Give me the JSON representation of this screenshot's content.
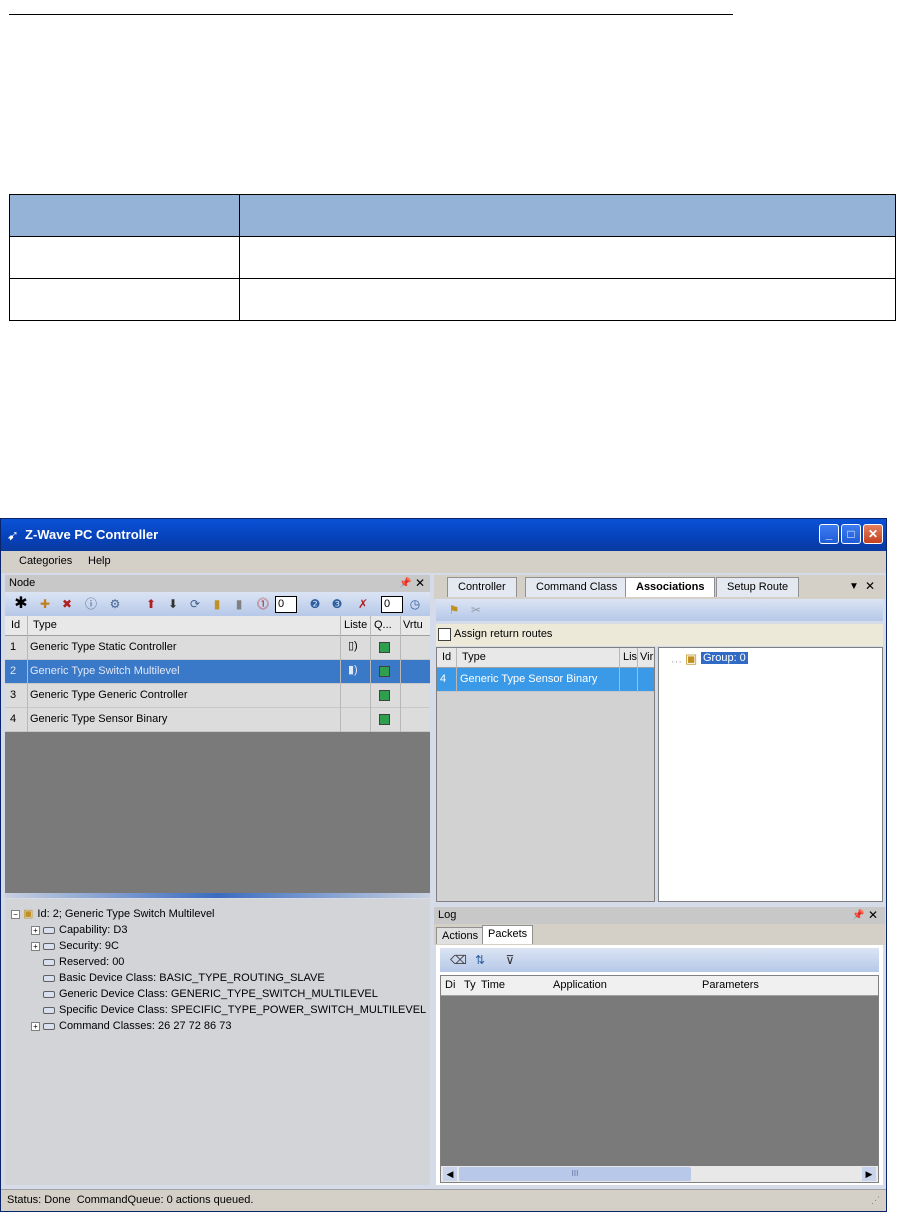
{
  "window": {
    "title": "Z-Wave PC Controller",
    "menu": [
      "Categories",
      "Help"
    ]
  },
  "node_panel": {
    "title": "Node",
    "spin1": "0",
    "spin2": "0",
    "columns": [
      "Id",
      "Type",
      "Liste",
      "Q...",
      "Vrtu"
    ],
    "rows": [
      {
        "id": "1",
        "type": "Generic Type Static Controller",
        "selected": false
      },
      {
        "id": "2",
        "type": "Generic Type Switch Multilevel",
        "selected": true
      },
      {
        "id": "3",
        "type": "Generic Type Generic Controller",
        "selected": false
      },
      {
        "id": "4",
        "type": "Generic Type Sensor Binary",
        "selected": false
      }
    ]
  },
  "details_tree": {
    "root": "Id: 2; Generic Type Switch Multilevel",
    "children": [
      "Capability: D3",
      "Security: 9C",
      "Reserved: 00",
      "Basic Device Class: BASIC_TYPE_ROUTING_SLAVE",
      "Generic Device Class: GENERIC_TYPE_SWITCH_MULTILEVEL",
      "Specific Device Class: SPECIFIC_TYPE_POWER_SWITCH_MULTILEVEL",
      "Command Classes: 26 27 72 86 73"
    ]
  },
  "tabs": [
    "Controller",
    "Command Class",
    "Associations",
    "Setup Route"
  ],
  "associations": {
    "assign_return_routes": "Assign return routes",
    "columns": [
      "Id",
      "Type",
      "Lis",
      "Vir"
    ],
    "row": {
      "id": "4",
      "type": "Generic Type Sensor Binary"
    },
    "group": "Group: 0"
  },
  "log_panel": {
    "title": "Log",
    "tabs": [
      "Actions",
      "Packets"
    ],
    "columns": [
      "Di",
      "Ty",
      "Time",
      "Application",
      "Parameters"
    ],
    "scroll_grip": "III"
  },
  "status": "Status: Done  CommandQueue: 0 actions queued."
}
